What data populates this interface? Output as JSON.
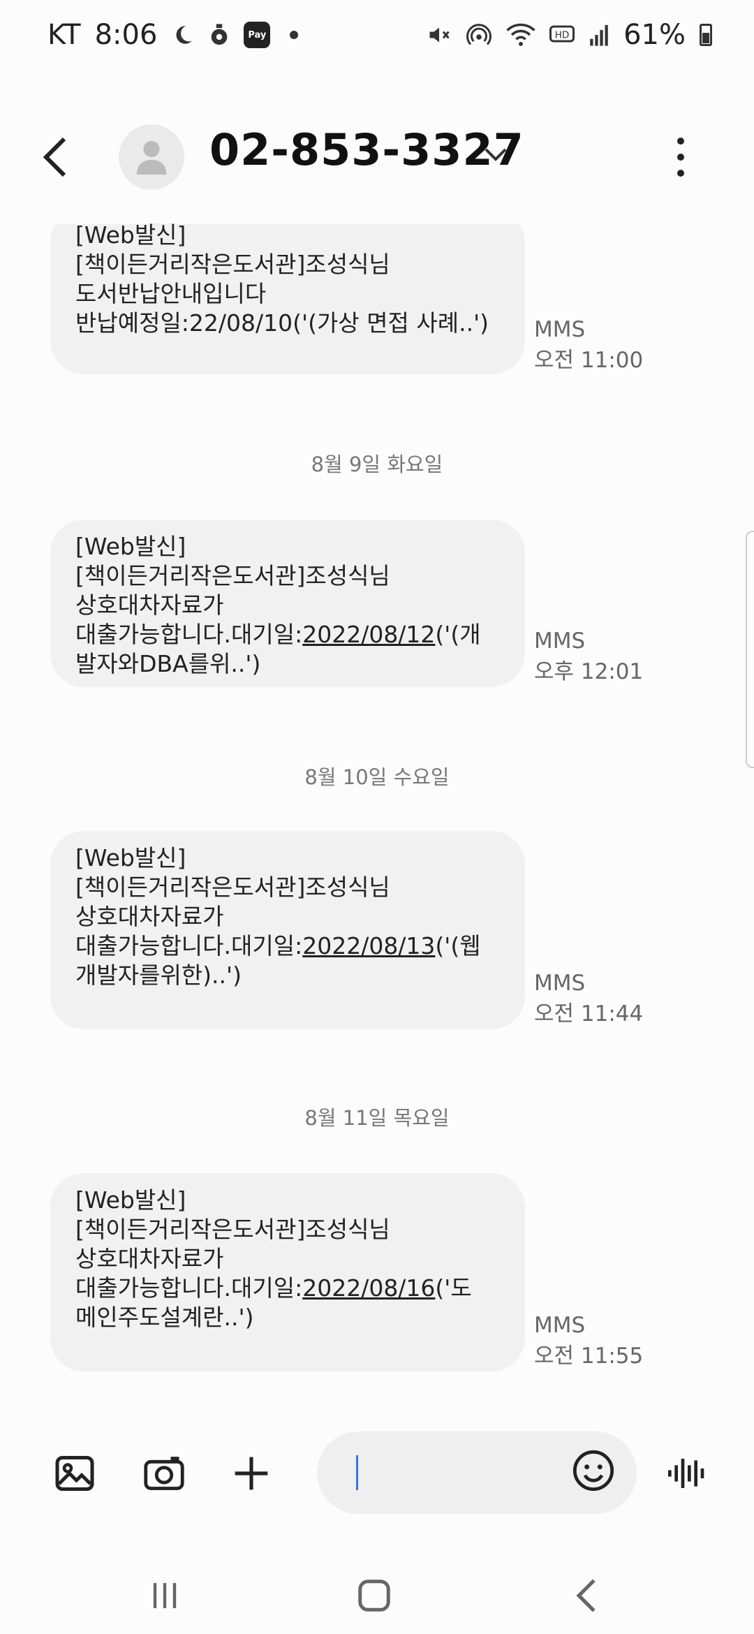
{
  "status_bar": {
    "carrier": "KT",
    "time": "8:06",
    "pay_label": "Pay",
    "battery": "61%",
    "icons": [
      "moon-icon",
      "location-icon",
      "pay-icon",
      "dot-icon",
      "mute-icon",
      "hotspot-icon",
      "wifi-icon",
      "hd-icon",
      "signal-icon",
      "battery-icon"
    ]
  },
  "header": {
    "contact": "02-853-3327"
  },
  "messages": [
    {
      "lines": [
        "[Web발신]",
        "[책이든거리작은도서관]조성식님",
        "도서반납안내입니다",
        "반납예정일:22/08/10('(가상 면접 사례..')"
      ],
      "type": "MMS",
      "time": "오전 11:00"
    },
    {
      "date": "8월 9일 화요일",
      "lines": [
        "[Web발신]",
        "[책이든거리작은도서관]조성식님",
        "상호대차자료가"
      ],
      "line4_prefix": "대출가능합니다.대기일:",
      "line4_link": "2022/08/12",
      "line4_suffix": "('(개",
      "line5": "발자와DBA를위..')",
      "type": "MMS",
      "time": "오후 12:01"
    },
    {
      "date": "8월 10일 수요일",
      "lines": [
        "[Web발신]",
        "[책이든거리작은도서관]조성식님",
        "상호대차자료가"
      ],
      "line4_prefix": "대출가능합니다.대기일:",
      "line4_link": "2022/08/13",
      "line4_suffix": "('(웹",
      "line5": "개발자를위한)..')",
      "type": "MMS",
      "time": "오전 11:44"
    },
    {
      "date": "8월 11일 목요일",
      "lines": [
        "[Web발신]",
        "[책이든거리작은도서관]조성식님",
        "상호대차자료가"
      ],
      "line4_prefix": "대출가능합니다.대기일:",
      "line4_link": "2022/08/16",
      "line4_suffix": "('도",
      "line5": "메인주도설계란..')",
      "type": "MMS",
      "time": "오전 11:55"
    }
  ],
  "composer": {
    "icons": [
      "gallery-icon",
      "camera-icon",
      "plus-icon",
      "emoji-icon",
      "voice-icon"
    ],
    "input_value": ""
  },
  "navbar": {
    "icons": [
      "recent-apps-icon",
      "home-icon",
      "back-icon"
    ]
  }
}
